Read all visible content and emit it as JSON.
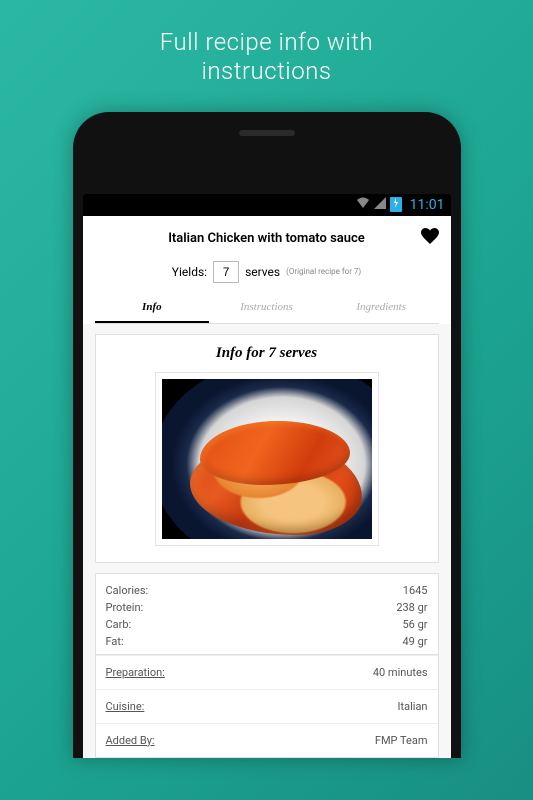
{
  "promo": {
    "line1": "Full recipe info with",
    "line2": "instructions"
  },
  "status": {
    "time": "11:01",
    "battery_icon_label": "batt"
  },
  "header": {
    "title": "Italian Chicken with tomato sauce"
  },
  "yields": {
    "label": "Yields:",
    "value": "7",
    "suffix": "serves",
    "note": "(Original recipe for 7)"
  },
  "tabs": {
    "info": "Info",
    "instructions": "Instructions",
    "ingredients": "Ingredients"
  },
  "card": {
    "heading": "Info for 7 serves"
  },
  "nutrition": {
    "calories_label": "Calories:",
    "calories_value": "1645",
    "protein_label": "Protein:",
    "protein_value": "238 gr",
    "carb_label": "Carb:",
    "carb_value": "56 gr",
    "fat_label": "Fat:",
    "fat_value": "49 gr"
  },
  "meta": {
    "prep_label": "Preparation:",
    "prep_value": "40 minutes",
    "cuisine_label": "Cuisine:",
    "cuisine_value": "Italian",
    "added_label": "Added By:",
    "added_value": "FMP Team"
  }
}
